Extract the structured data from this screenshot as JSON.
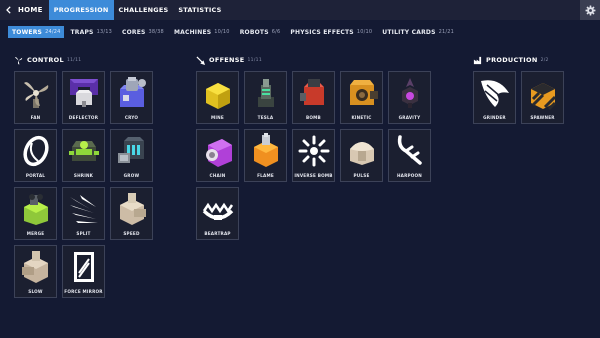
{
  "topbar": {
    "home_label": "HOME",
    "tabs": [
      {
        "label": "PROGRESSION"
      },
      {
        "label": "CHALLENGES"
      },
      {
        "label": "STATISTICS"
      }
    ]
  },
  "subtabs": [
    {
      "label": "TOWERS",
      "count": "24/24"
    },
    {
      "label": "TRAPS",
      "count": "13/13"
    },
    {
      "label": "CORES",
      "count": "38/38"
    },
    {
      "label": "MACHINES",
      "count": "10/10"
    },
    {
      "label": "ROBOTS",
      "count": "6/6"
    },
    {
      "label": "PHYSICS EFFECTS",
      "count": "10/10"
    },
    {
      "label": "UTILITY CARDS",
      "count": "21/21"
    }
  ],
  "sections": {
    "control": {
      "title": "CONTROL",
      "count": "11/11",
      "items": [
        "FAN",
        "DEFLECTOR",
        "CRYO",
        "PORTAL",
        "SHRINK",
        "GROW",
        "MERGE",
        "SPLIT",
        "SPEED",
        "SLOW",
        "FORCE MIRROR"
      ]
    },
    "offense": {
      "title": "OFFENSE",
      "count": "11/11",
      "items": [
        "MINE",
        "TESLA",
        "BOMB",
        "KINETIC",
        "GRAVITY",
        "CHAIN",
        "FLAME",
        "INVERSE BOMB",
        "PULSE",
        "HARPOON",
        "BEARTRAP"
      ]
    },
    "production": {
      "title": "PRODUCTION",
      "count": "2/2",
      "items": [
        "GRINDER",
        "SPAWNER"
      ]
    }
  },
  "icons": {
    "control": "fan-icon",
    "offense": "sword-icon",
    "production": "factory-icon",
    "settings": "gear-icon",
    "home": "back-arrow-icon"
  },
  "colors": {
    "background": "#141a33",
    "topbar": "#1e2238",
    "accent": "#3d8bd9",
    "card_border": "#3c4258"
  }
}
